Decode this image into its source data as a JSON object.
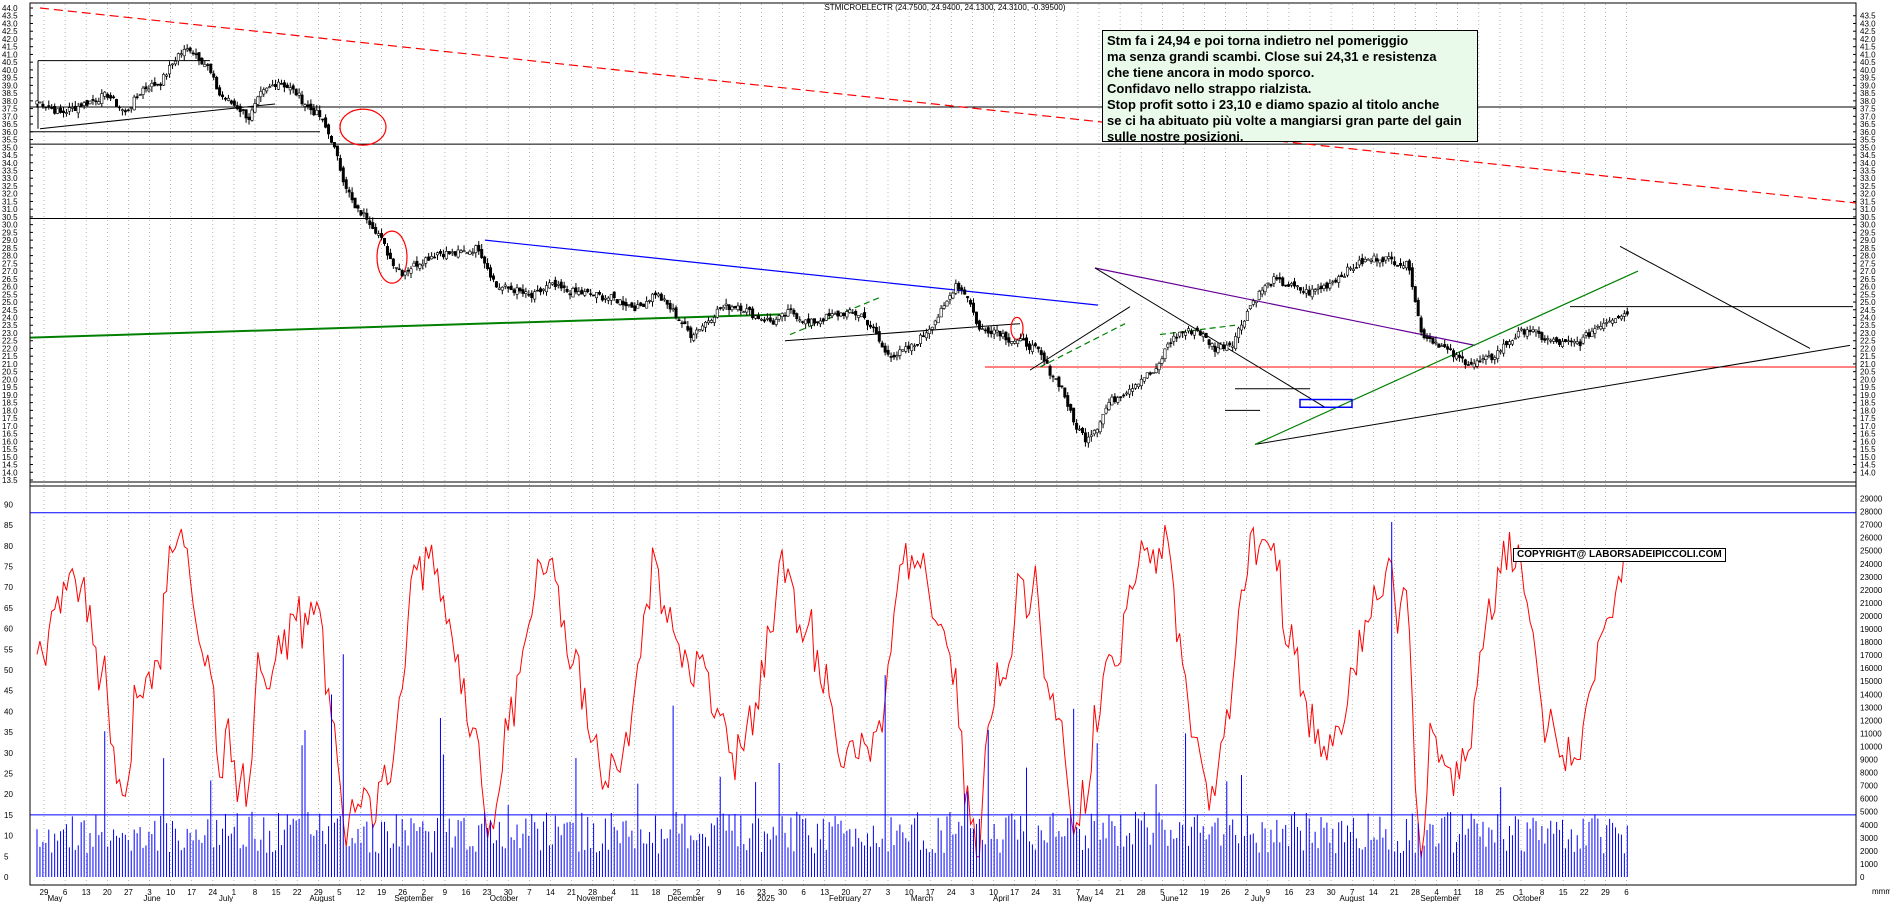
{
  "chart_data": [
    {
      "type": "candlestick",
      "title": "STMICROELECTR (24.7500, 24.9400, 24.1300, 24.3100, -0.39500)",
      "ylim": [
        13.5,
        44.0
      ],
      "y_ticks": [
        13.5,
        14.0,
        14.5,
        15.0,
        15.5,
        16.0,
        16.5,
        17.0,
        17.5,
        18.0,
        18.5,
        19.0,
        19.5,
        20.0,
        20.5,
        21.0,
        21.5,
        22.0,
        22.5,
        23.0,
        23.5,
        24.0,
        24.5,
        25.0,
        25.5,
        26.0,
        26.5,
        27.0,
        27.5,
        28.0,
        28.5,
        29.0,
        29.5,
        30.0,
        30.5,
        31.0,
        31.5,
        32.0,
        32.5,
        33.0,
        33.5,
        34.0,
        34.5,
        35.0,
        35.5,
        36.0,
        36.5,
        37.0,
        37.5,
        38.0,
        38.5,
        39.0,
        39.5,
        40.0,
        40.5,
        41.0,
        41.5,
        42.0,
        42.5,
        43.0,
        43.5,
        44.0
      ],
      "y_ticks_right": [
        14.0,
        14.5,
        15.0,
        15.5,
        16.0,
        16.5,
        17.0,
        17.5,
        18.0,
        18.5,
        19.0,
        19.5,
        20.0,
        20.5,
        21.0,
        21.5,
        22.0,
        22.5,
        23.0,
        23.5,
        24.0,
        24.5,
        25.0,
        25.5,
        26.0,
        26.5,
        27.0,
        27.5,
        28.0,
        28.5,
        29.0,
        29.5,
        30.0,
        30.5,
        31.0,
        31.5,
        32.0,
        32.5,
        33.0,
        33.5,
        34.0,
        34.5,
        35.0,
        35.5,
        36.0,
        36.5,
        37.0,
        37.5,
        38.0,
        38.5,
        39.0,
        39.5,
        40.0,
        40.5,
        41.0,
        41.5,
        42.0,
        42.5,
        43.0,
        43.5
      ],
      "waypoints": [
        [
          0,
          38.0
        ],
        [
          8,
          37.2
        ],
        [
          16,
          37.8
        ],
        [
          24,
          38.4
        ],
        [
          30,
          37.2
        ],
        [
          36,
          38.8
        ],
        [
          42,
          39.2
        ],
        [
          48,
          41.0
        ],
        [
          52,
          41.4
        ],
        [
          58,
          40.2
        ],
        [
          62,
          38.4
        ],
        [
          68,
          37.6
        ],
        [
          72,
          36.9
        ],
        [
          76,
          38.4
        ],
        [
          82,
          39.3
        ],
        [
          88,
          38.5
        ],
        [
          92,
          37.6
        ],
        [
          96,
          37.0
        ],
        [
          100,
          35.5
        ],
        [
          104,
          33.0
        ],
        [
          108,
          31.0
        ],
        [
          112,
          30.5
        ],
        [
          116,
          29.4
        ],
        [
          120,
          27.8
        ],
        [
          124,
          26.9
        ],
        [
          130,
          27.6
        ],
        [
          136,
          28.2
        ],
        [
          142,
          28.1
        ],
        [
          150,
          28.5
        ],
        [
          156,
          26.0
        ],
        [
          162,
          25.8
        ],
        [
          168,
          25.3
        ],
        [
          174,
          26.1
        ],
        [
          180,
          25.7
        ],
        [
          188,
          25.5
        ],
        [
          196,
          25.2
        ],
        [
          204,
          24.6
        ],
        [
          210,
          25.6
        ],
        [
          216,
          24.4
        ],
        [
          222,
          22.9
        ],
        [
          226,
          23.5
        ],
        [
          232,
          24.6
        ],
        [
          238,
          24.8
        ],
        [
          244,
          24.1
        ],
        [
          250,
          23.7
        ],
        [
          256,
          24.4
        ],
        [
          262,
          23.6
        ],
        [
          268,
          24.0
        ],
        [
          274,
          24.3
        ],
        [
          280,
          24.2
        ],
        [
          284,
          23.2
        ],
        [
          288,
          21.7
        ],
        [
          292,
          21.6
        ],
        [
          298,
          22.2
        ],
        [
          304,
          23.6
        ],
        [
          308,
          24.6
        ],
        [
          312,
          26.2
        ],
        [
          316,
          25.4
        ],
        [
          320,
          23.2
        ],
        [
          326,
          23.2
        ],
        [
          330,
          22.6
        ],
        [
          336,
          22.3
        ],
        [
          340,
          21.8
        ],
        [
          344,
          20.5
        ],
        [
          348,
          19.5
        ],
        [
          352,
          17.2
        ],
        [
          356,
          16.2
        ],
        [
          360,
          17.0
        ],
        [
          364,
          18.5
        ],
        [
          370,
          19.3
        ],
        [
          376,
          20.2
        ],
        [
          380,
          20.5
        ],
        [
          384,
          22.3
        ],
        [
          388,
          23.0
        ],
        [
          394,
          23.2
        ],
        [
          400,
          22.0
        ],
        [
          406,
          22.4
        ],
        [
          412,
          24.8
        ],
        [
          416,
          25.8
        ],
        [
          420,
          26.4
        ],
        [
          426,
          26.0
        ],
        [
          432,
          25.6
        ],
        [
          438,
          26.1
        ],
        [
          444,
          26.9
        ],
        [
          450,
          27.6
        ],
        [
          456,
          27.9
        ],
        [
          462,
          27.6
        ],
        [
          466,
          27.3
        ],
        [
          470,
          23.0
        ],
        [
          476,
          22.3
        ],
        [
          482,
          21.4
        ],
        [
          488,
          21.0
        ],
        [
          494,
          21.4
        ],
        [
          500,
          22.5
        ],
        [
          506,
          23.3
        ],
        [
          512,
          22.6
        ],
        [
          518,
          22.3
        ],
        [
          524,
          22.4
        ],
        [
          530,
          23.5
        ],
        [
          536,
          24.1
        ],
        [
          540,
          24.3
        ]
      ],
      "volume_ylim": [
        0,
        29500
      ],
      "volume_ticks": [
        0,
        1000,
        2000,
        3000,
        4000,
        5000,
        6000,
        7000,
        8000,
        9000,
        10000,
        11000,
        12000,
        13000,
        14000,
        15000,
        16000,
        17000,
        18000,
        19000,
        20000,
        21000,
        22000,
        23000,
        24000,
        25000,
        26000,
        27000,
        28000,
        29000
      ]
    },
    {
      "type": "line",
      "ylim": [
        0,
        93
      ],
      "y_ticks": [
        0,
        5,
        10,
        15,
        20,
        25,
        30,
        35,
        40,
        45,
        50,
        55,
        60,
        65,
        70,
        75,
        80,
        85,
        90
      ],
      "levels": [
        15,
        88
      ]
    }
  ],
  "x_axis": {
    "day_ticks": [
      "29",
      "6",
      "13",
      "20",
      "27",
      "3",
      "10",
      "17",
      "24",
      "1",
      "8",
      "15",
      "22",
      "29",
      "5",
      "12",
      "19",
      "26",
      "2",
      "9",
      "16",
      "23",
      "30",
      "7",
      "14",
      "21",
      "28",
      "4",
      "11",
      "18",
      "25",
      "2",
      "9",
      "16",
      "23",
      "30",
      "6",
      "13",
      "20",
      "27",
      "3",
      "10",
      "17",
      "24",
      "3",
      "10",
      "17",
      "24",
      "31",
      "7",
      "14",
      "21",
      "28",
      "5",
      "12",
      "19",
      "26",
      "2",
      "9",
      "16",
      "23",
      "30",
      "7",
      "14",
      "21",
      "28",
      "4",
      "11",
      "18",
      "25",
      "1",
      "8",
      "15",
      "22",
      "29",
      "6"
    ],
    "months": [
      "May",
      "June",
      "July",
      "August",
      "September",
      "October",
      "November",
      "December",
      "2025",
      "February",
      "March",
      "April",
      "May",
      "June",
      "July",
      "August",
      "September",
      "October"
    ],
    "right_edge_label": "mmm"
  },
  "annotation": {
    "lines": [
      "Stm fa i 24,94 e poi torna indietro nel pomeriggio",
      "ma senza grandi scambi. Close sui 24,31 e resistenza",
      "che tiene ancora in modo sporco.",
      "Confidavo nello strappo rialzista.",
      "Stop profit sotto i 23,10 e diamo spazio al titolo anche",
      "se ci ha abituato più volte a mangiarsi gran parte del gain",
      "sulle nostre posizioni."
    ]
  },
  "copyright": "COPYRIGHT@ LABORSADEIPICCOLI.COM",
  "colors": {
    "price": "#000000",
    "up_candle": "#ffffff",
    "oscillator": "#ff0000",
    "volume": "#0000ff",
    "trend_red": "#ff0000",
    "trend_green": "#008000",
    "trend_blue": "#0000ff",
    "trend_purple": "#660099",
    "grid": "#888888"
  }
}
